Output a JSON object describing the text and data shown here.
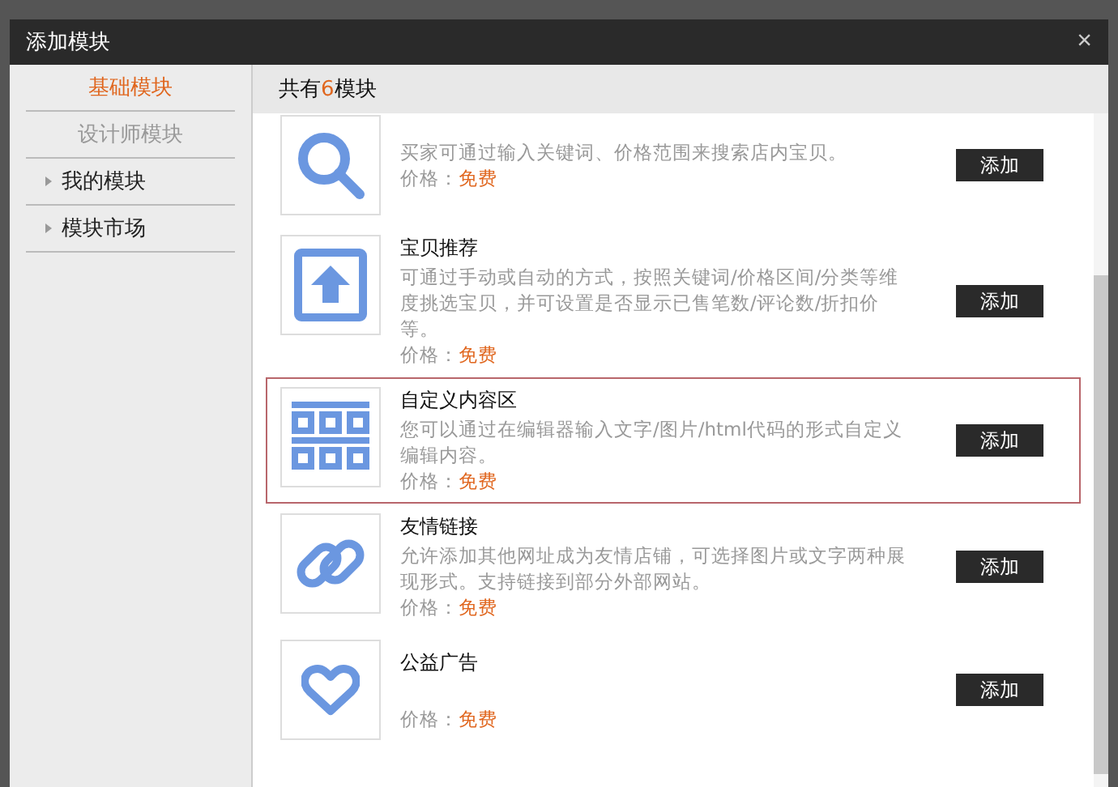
{
  "window": {
    "title": "添加模块",
    "close": "×"
  },
  "sidebar": {
    "items": [
      {
        "label": "基础模块",
        "selected": true,
        "disabled": false,
        "expandable": false
      },
      {
        "label": "设计师模块",
        "selected": false,
        "disabled": true,
        "expandable": false
      },
      {
        "label": "我的模块",
        "selected": false,
        "disabled": false,
        "expandable": true
      },
      {
        "label": "模块市场",
        "selected": false,
        "disabled": false,
        "expandable": true
      }
    ]
  },
  "header": {
    "prefix": "共有",
    "count": "6",
    "suffix": "模块"
  },
  "modules": [
    {
      "kind": "search",
      "description": "买家可通过输入关键词、价格范围来搜索店内宝贝。",
      "price_label": "价格：",
      "price": "免费",
      "button": "添加",
      "selected": false
    },
    {
      "kind": "upload",
      "title": "宝贝推荐",
      "description": "可通过手动或自动的方式，按照关键词/价格区间/分类等维度挑选宝贝，并可设置是否显示已售笔数/评论数/折扣价等。",
      "price_label": "价格：",
      "price": "免费",
      "button": "添加",
      "selected": false
    },
    {
      "kind": "grid",
      "title": "自定义内容区",
      "description": "您可以通过在编辑器输入文字/图片/html代码的形式自定义编辑内容。",
      "price_label": "价格：",
      "price": "免费",
      "button": "添加",
      "selected": true
    },
    {
      "kind": "link",
      "title": "友情链接",
      "description": "允许添加其他网址成为友情店铺，可选择图片或文字两种展现形式。支持链接到部分外部网站。",
      "price_label": "价格：",
      "price": "免费",
      "button": "添加",
      "selected": false
    },
    {
      "kind": "heart",
      "title": "公益广告",
      "price_label": "价格：",
      "price": "免费",
      "button": "添加",
      "selected": false
    }
  ]
}
